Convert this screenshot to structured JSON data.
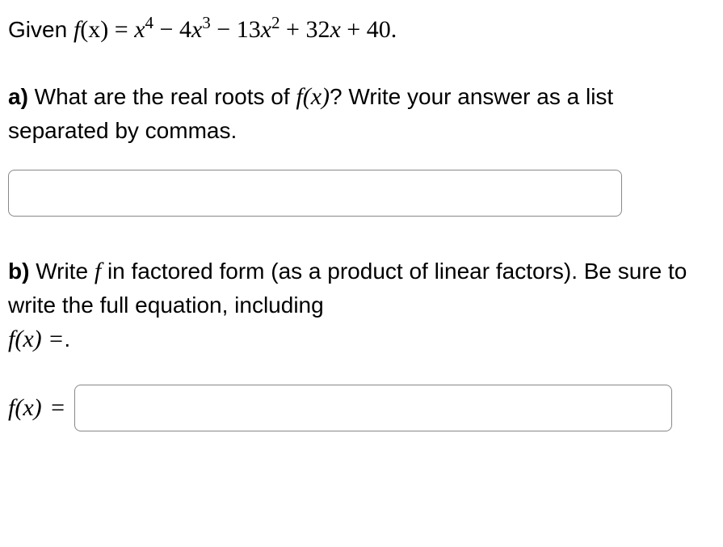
{
  "given": {
    "prefix": "Given ",
    "equation_parts": {
      "fx": "f",
      "paren_x": "(x)",
      "eq": " = ",
      "t1_x": "x",
      "t1_exp": "4",
      "op1": " − ",
      "t2_coef": "4",
      "t2_x": "x",
      "t2_exp": "3",
      "op2": " − ",
      "t3_coef": "13",
      "t3_x": "x",
      "t3_exp": "2",
      "op3": " + ",
      "t4_coef": "32",
      "t4_x": "x",
      "op4": " + ",
      "t5": "40",
      "end": "."
    }
  },
  "part_a": {
    "label": "a)",
    "text_before": " What are the real roots of ",
    "fx_inline": "f(x)",
    "text_after": "? Write your answer as a list separated by commas.",
    "input_value": ""
  },
  "part_b": {
    "label": "b)",
    "text_1": " Write ",
    "f_inline": "f",
    "text_2": " in factored form (as a product of linear factors). Be sure to write the full equation, including ",
    "fxeq_inline": "f(x) =",
    "text_3": ".",
    "answer_prefix_f": "f",
    "answer_prefix_x": "(x)",
    "answer_prefix_eq": " =",
    "input_value": ""
  }
}
